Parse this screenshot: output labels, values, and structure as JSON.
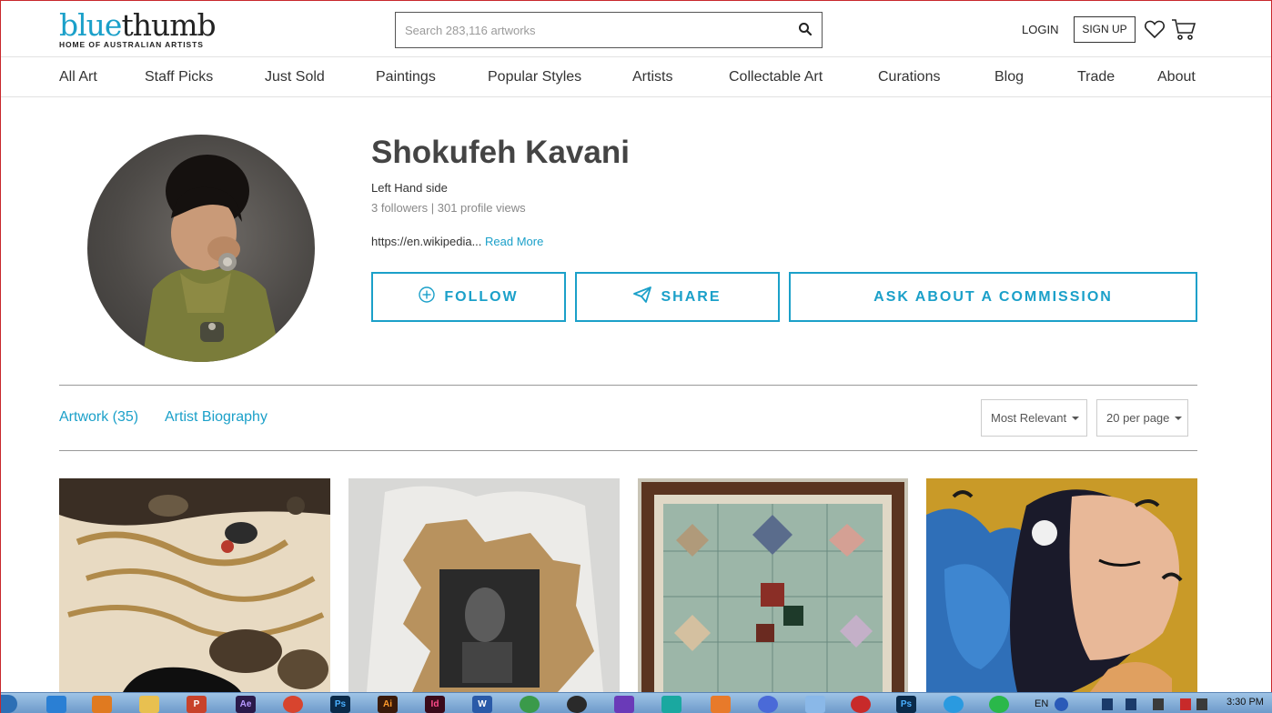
{
  "header": {
    "logo_part1": "blue",
    "logo_part2": "thumb",
    "logo_tagline": "HOME OF AUSTRALIAN ARTISTS",
    "search_placeholder": "Search 283,116 artworks",
    "login_label": "LOGIN",
    "signup_label": "SIGN UP",
    "icons": [
      "search-icon",
      "heart-icon",
      "cart-icon"
    ]
  },
  "nav": {
    "items": [
      {
        "label": "All Art"
      },
      {
        "label": "Staff Picks"
      },
      {
        "label": "Just Sold"
      },
      {
        "label": "Paintings"
      },
      {
        "label": "Popular Styles"
      },
      {
        "label": "Artists"
      },
      {
        "label": "Collectable Art"
      },
      {
        "label": "Curations"
      },
      {
        "label": "Blog"
      },
      {
        "label": "Trade"
      },
      {
        "label": "About"
      }
    ]
  },
  "profile": {
    "name": "Shokufeh Kavani",
    "location": "Left Hand side",
    "followers": "3 followers",
    "stats_sep": " | ",
    "views": "301 profile views",
    "bio_snippet": "https://en.wikipedia...",
    "read_more": "Read More",
    "follow_label": "FOLLOW",
    "share_label": "SHARE",
    "commission_label": "ASK ABOUT A COMMISSION"
  },
  "tabs": {
    "artwork_label": "Artwork (35)",
    "biography_label": "Artist Biography"
  },
  "filters": {
    "sort_selected": "Most Relevant",
    "per_page_selected": "20 per page"
  },
  "colors": {
    "accent": "#1ba0c9",
    "heading": "#444444",
    "text": "#333333",
    "muted": "#888888"
  },
  "taskbar": {
    "apps": [
      {
        "label": "",
        "icon": "ie-icon"
      },
      {
        "label": "",
        "icon": "media-player-icon"
      },
      {
        "label": "",
        "icon": "folder-icon"
      },
      {
        "label": "P",
        "icon": "powerpoint-icon"
      },
      {
        "label": "Ae",
        "icon": "after-effects-icon"
      },
      {
        "label": "",
        "icon": "chrome-icon"
      },
      {
        "label": "Ps",
        "icon": "photoshop-icon"
      },
      {
        "label": "Ai",
        "icon": "illustrator-icon"
      },
      {
        "label": "Id",
        "icon": "indesign-icon"
      },
      {
        "label": "W",
        "icon": "word-icon"
      },
      {
        "label": "",
        "icon": "recycle-icon"
      },
      {
        "label": "",
        "icon": "obs-icon"
      },
      {
        "label": "",
        "icon": "visual-studio-icon"
      },
      {
        "label": "",
        "icon": "filmora-icon"
      },
      {
        "label": "",
        "icon": "chart-app-icon"
      },
      {
        "label": "",
        "icon": "atom-icon"
      },
      {
        "label": "",
        "icon": "notepad-icon"
      },
      {
        "label": "",
        "icon": "eye-icon"
      },
      {
        "label": "Ps",
        "icon": "photoshop-icon-2"
      },
      {
        "label": "",
        "icon": "telegram-icon"
      },
      {
        "label": "",
        "icon": "whatsapp-icon"
      }
    ],
    "lang": "EN",
    "time": "3:30 PM"
  }
}
